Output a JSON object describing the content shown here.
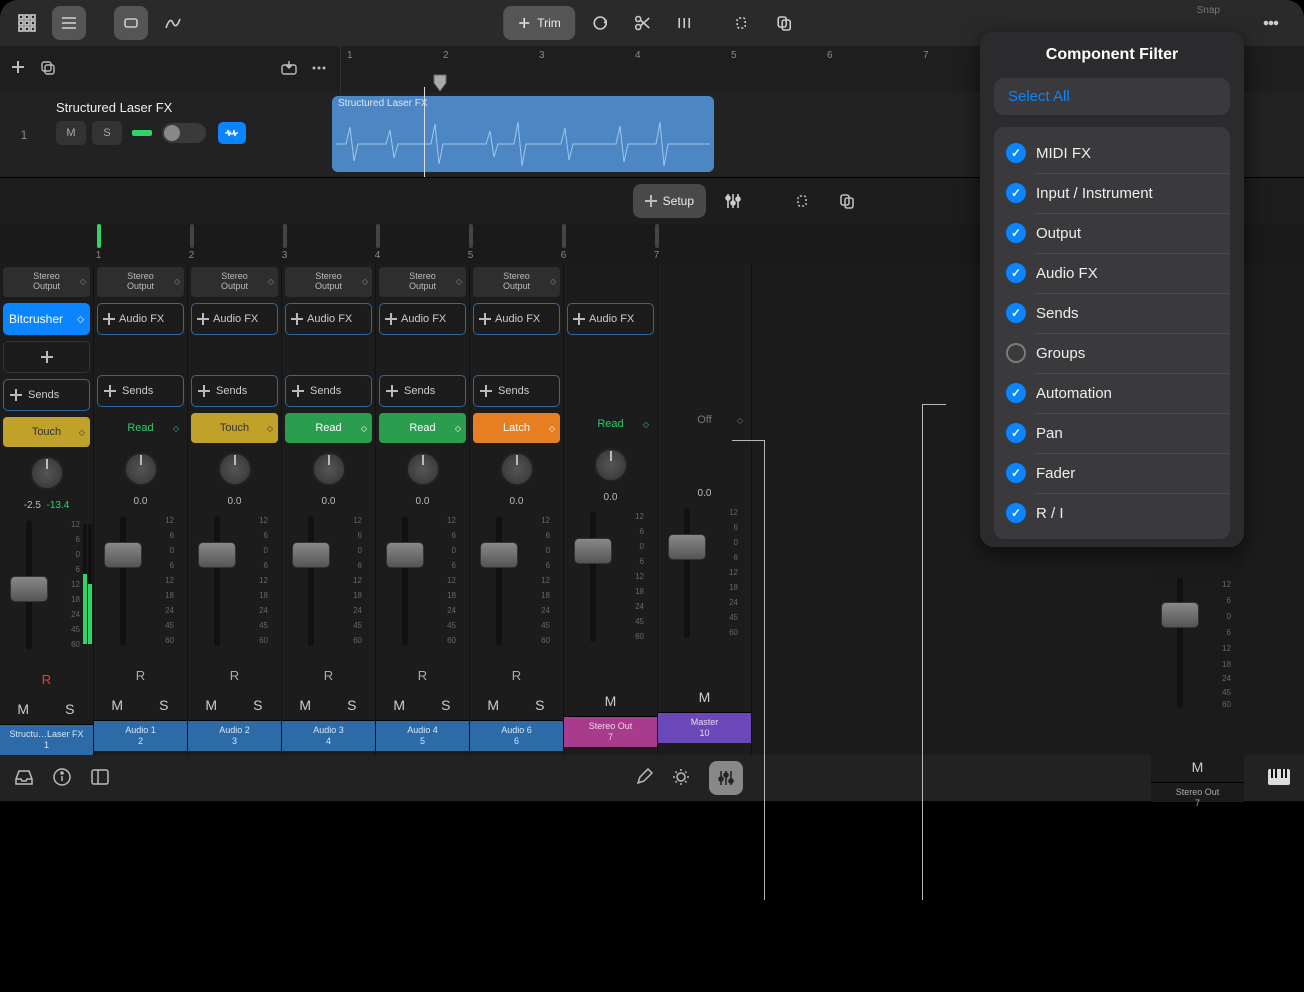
{
  "topbar": {
    "trim": "Trim",
    "snap": "Snap"
  },
  "ruler": {
    "bars": [
      1,
      2,
      3,
      4,
      5,
      6,
      7
    ]
  },
  "track": {
    "name": "Structured Laser FX",
    "region_label": "Structured Laser FX",
    "mute": "M",
    "solo": "S",
    "index": "1"
  },
  "subbar": {
    "setup": "Setup"
  },
  "mini_labels": [
    "1",
    "2",
    "3",
    "4",
    "5",
    "6",
    "7"
  ],
  "output_label": "Stereo\nOutput",
  "audio_fx": "Audio FX",
  "bitcrusher": "Bitcrusher",
  "sends": "Sends",
  "automation": [
    "Touch",
    "Read",
    "Touch",
    "Read",
    "Read",
    "Latch",
    "Read",
    "Off"
  ],
  "pan": [
    "-2.5",
    "0.0",
    "0.0",
    "0.0",
    "0.0",
    "0.0",
    "0.0",
    "0.0"
  ],
  "pan_extra": "-13.4",
  "rec": "R",
  "mute": "M",
  "solo": "S",
  "scale": [
    "12",
    "6",
    "0",
    "6",
    "12",
    "18",
    "24",
    "45",
    "60"
  ],
  "labels": [
    {
      "name": "Structu…Laser FX",
      "num": "1",
      "cls": "lbl-blue"
    },
    {
      "name": "Audio 1",
      "num": "2",
      "cls": "lbl-blue"
    },
    {
      "name": "Audio 2",
      "num": "3",
      "cls": "lbl-blue"
    },
    {
      "name": "Audio 3",
      "num": "4",
      "cls": "lbl-blue"
    },
    {
      "name": "Audio 4",
      "num": "5",
      "cls": "lbl-blue"
    },
    {
      "name": "Audio 6",
      "num": "6",
      "cls": "lbl-blue"
    },
    {
      "name": "Stereo Out",
      "num": "7",
      "cls": "lbl-mag"
    },
    {
      "name": "Master",
      "num": "10",
      "cls": "lbl-pur"
    }
  ],
  "right_strip": {
    "name": "Stereo Out",
    "num": "7",
    "mute": "M"
  },
  "panel": {
    "title": "Component Filter",
    "select_all": "Select All",
    "options": [
      {
        "label": "MIDI FX",
        "checked": true
      },
      {
        "label": "Input / Instrument",
        "checked": true
      },
      {
        "label": "Output",
        "checked": true
      },
      {
        "label": "Audio FX",
        "checked": true
      },
      {
        "label": "Sends",
        "checked": true
      },
      {
        "label": "Groups",
        "checked": false
      },
      {
        "label": "Automation",
        "checked": true
      },
      {
        "label": "Pan",
        "checked": true
      },
      {
        "label": "Fader",
        "checked": true
      },
      {
        "label": "R / I",
        "checked": true
      }
    ]
  }
}
